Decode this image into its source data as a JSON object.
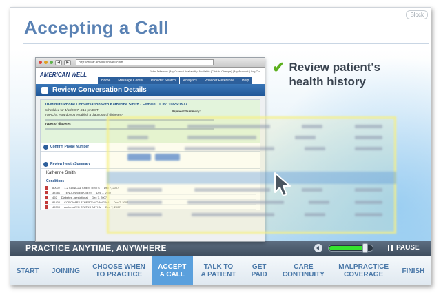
{
  "slide": {
    "title": "Accepting a Call",
    "block_label": "Block",
    "callout": "Review patient's health history"
  },
  "browser": {
    "url": "http://www.americanwell.com",
    "logo": "AMERICAN WELL",
    "links": "John Jefferson | My Current Availability: Available (Click to Change) | My Account | Log Out",
    "nav": [
      "Home",
      "Message Center",
      "Provider Search",
      "Analytics",
      "Provider Reference",
      "Help"
    ],
    "page_title": "Review Conversation Details",
    "summary_heading": "10-Minute Phone Conversation with Katherine Smith - Female, DOB: 10/26/1977",
    "scheduled": "Scheduled for 4/13/2007, 4:15 pm EST",
    "payment_summary": "Payment Summary:",
    "topics": "TOPIC/S: How do you establish a diagnosis of diabetes?",
    "types": "Types of diabetes",
    "confirm_phone": "Confirm Phone Number",
    "review_health": "Review Health Summary",
    "patient": "Katherine Smith",
    "conditions": "Conditions",
    "condition_rows": [
      {
        "code": "80002",
        "desc": "1-2 CLINICAL CHEM TESTS",
        "date": "Dec 7, 2007"
      },
      {
        "code": "38781",
        "desc": "TENDON WEAKNESS",
        "date": "Dec 7, 2007"
      },
      {
        "code": "492",
        "desc": "Diabetes - gestational",
        "date": "Dec 7, 2007"
      },
      {
        "code": "81400",
        "desc": "CORONARY ATHERO W/O ANGINA",
        "date": "Dec 7, 2007"
      },
      {
        "code": "49390",
        "desc": "Asthma W/O STATUS ASTHM",
        "date": "Dec 7, 2007"
      }
    ]
  },
  "controls": {
    "title": "PRACTICE ANYTIME, ANYWHERE",
    "pause_label": "PAUSE",
    "volume_level": 0.85
  },
  "tabs": [
    {
      "label": "START",
      "active": false
    },
    {
      "label": "JOINING",
      "active": false
    },
    {
      "label": "CHOOSE WHEN\nTO PRACTICE",
      "active": false
    },
    {
      "label": "ACCEPT\nA CALL",
      "active": true
    },
    {
      "label": "TALK TO\nA PATIENT",
      "active": false
    },
    {
      "label": "GET\nPAID",
      "active": false
    },
    {
      "label": "CARE\nCONTINUITY",
      "active": false
    },
    {
      "label": "MALPRACTICE\nCOVERAGE",
      "active": false
    },
    {
      "label": "FINISH",
      "active": false
    }
  ],
  "colors": {
    "title": "#5a82b4",
    "accent": "#5aa0dd",
    "check": "#5cb01e",
    "volume": "#36e22e"
  }
}
